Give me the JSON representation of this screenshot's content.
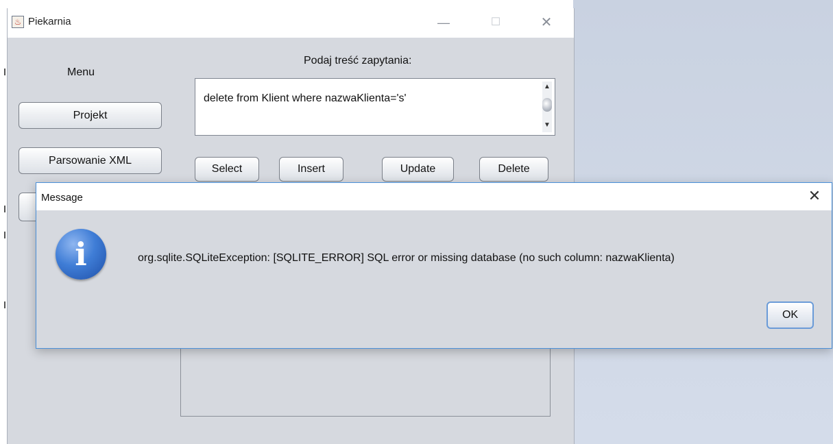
{
  "main_window": {
    "title": "Piekarnia",
    "controls": {
      "minimize": "—",
      "maximize": "☐",
      "close": "✕"
    },
    "menu_label": "Menu",
    "menu_buttons": [
      "Projekt",
      "Parsowanie XML"
    ],
    "query_label": "Podaj treść zapytania:",
    "query_text": "delete from Klient where nazwaKlienta='s'",
    "action_buttons": [
      "Select",
      "Insert",
      "Update",
      "Delete"
    ]
  },
  "dialog": {
    "title": "Message",
    "close_glyph": "✕",
    "icon_glyph": "i",
    "message": "org.sqlite.SQLiteException: [SQLITE_ERROR] SQL error or missing database (no such column: nazwaKlienta)",
    "ok_label": "OK"
  },
  "colors": {
    "window_background": "#d6d9df",
    "dialog_border": "#4a90d9",
    "info_icon_blue": "#3f7dd6",
    "desktop": "#c9d2e1"
  },
  "icons": {
    "app": "java-cup-icon",
    "info": "information-icon"
  }
}
